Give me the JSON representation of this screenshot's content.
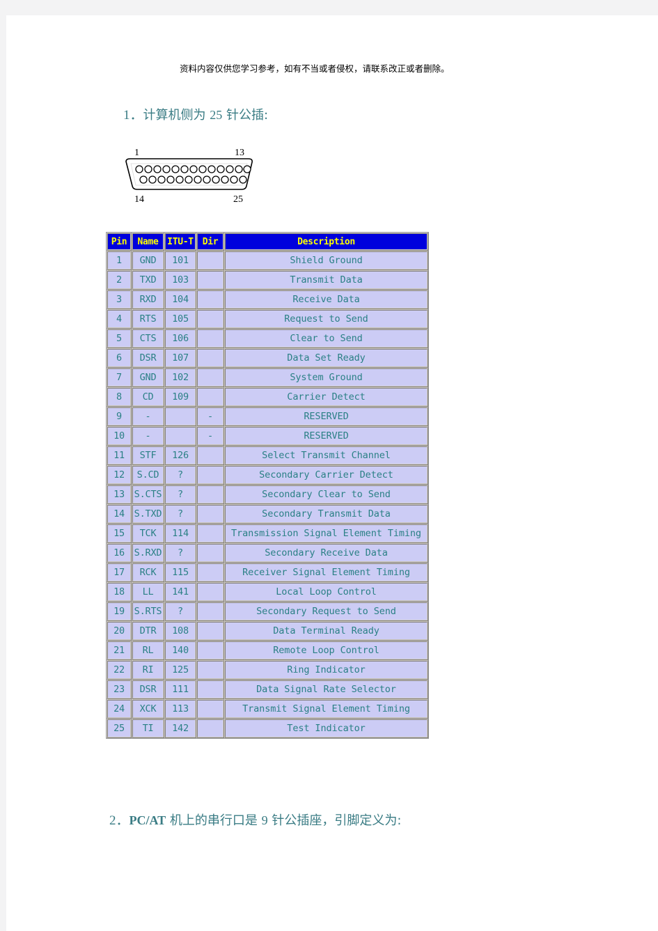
{
  "page": {
    "disclaimer": "资料内容仅供您学习参考，如有不当或者侵权，请联系改正或者删除。"
  },
  "sections": [
    {
      "number": "1．",
      "title_cn_a": "计算机侧为 ",
      "title_num": "25",
      "title_cn_b": " 针公插:"
    },
    {
      "number": "2．",
      "latin": "PC/AT",
      "title_cn_a": " 机上的串行口是 ",
      "title_num": "9",
      "title_cn_b": " 针公插座，引脚定义为:"
    }
  ],
  "connector": {
    "name": "db25-male-connector",
    "label_top_left": "1",
    "label_top_right": "13",
    "label_bottom_left": "14",
    "label_bottom_right": "25",
    "top_row_pins": 13,
    "bottom_row_pins": 12
  },
  "table": {
    "headers": [
      "Pin",
      "Name",
      "ITU-T",
      "Dir",
      "Description"
    ],
    "header_bg": "#0000dd",
    "header_fg": "#ffff00",
    "cell_bg": "#ccccf5",
    "cell_fg": "#2a8085",
    "rows": [
      [
        "1",
        "GND",
        "101",
        "",
        "Shield Ground"
      ],
      [
        "2",
        "TXD",
        "103",
        "",
        "Transmit Data"
      ],
      [
        "3",
        "RXD",
        "104",
        "",
        "Receive Data"
      ],
      [
        "4",
        "RTS",
        "105",
        "",
        "Request to Send"
      ],
      [
        "5",
        "CTS",
        "106",
        "",
        "Clear to Send"
      ],
      [
        "6",
        "DSR",
        "107",
        "",
        "Data Set Ready"
      ],
      [
        "7",
        "GND",
        "102",
        "",
        "System Ground"
      ],
      [
        "8",
        "CD",
        "109",
        "",
        "Carrier Detect"
      ],
      [
        "9",
        "-",
        "",
        "-",
        "RESERVED"
      ],
      [
        "10",
        "-",
        "",
        "-",
        "RESERVED"
      ],
      [
        "11",
        "STF",
        "126",
        "",
        "Select Transmit Channel"
      ],
      [
        "12",
        "S.CD",
        "?",
        "",
        "Secondary Carrier Detect"
      ],
      [
        "13",
        "S.CTS",
        "?",
        "",
        "Secondary Clear to Send"
      ],
      [
        "14",
        "S.TXD",
        "?",
        "",
        "Secondary Transmit Data"
      ],
      [
        "15",
        "TCK",
        "114",
        "",
        "Transmission Signal Element Timing"
      ],
      [
        "16",
        "S.RXD",
        "?",
        "",
        "Secondary Receive Data"
      ],
      [
        "17",
        "RCK",
        "115",
        "",
        "Receiver Signal Element Timing"
      ],
      [
        "18",
        "LL",
        "141",
        "",
        "Local Loop Control"
      ],
      [
        "19",
        "S.RTS",
        "?",
        "",
        "Secondary Request to Send"
      ],
      [
        "20",
        "DTR",
        "108",
        "",
        "Data Terminal Ready"
      ],
      [
        "21",
        "RL",
        "140",
        "",
        "Remote Loop Control"
      ],
      [
        "22",
        "RI",
        "125",
        "",
        "Ring Indicator"
      ],
      [
        "23",
        "DSR",
        "111",
        "",
        "Data Signal Rate Selector"
      ],
      [
        "24",
        "XCK",
        "113",
        "",
        "Transmit Signal Element Timing"
      ],
      [
        "25",
        "TI",
        "142",
        "",
        "Test Indicator"
      ]
    ]
  }
}
